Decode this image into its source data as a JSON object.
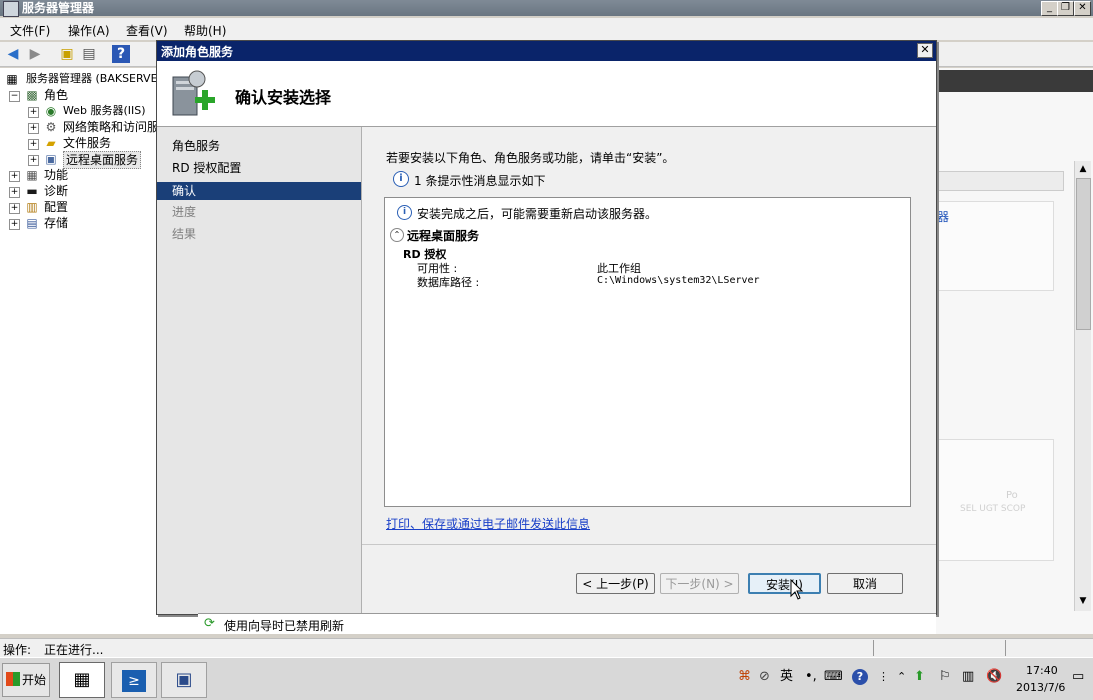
{
  "window": {
    "title": "服务器管理器"
  },
  "menu": [
    "文件(F)",
    "操作(A)",
    "查看(V)",
    "帮助(H)"
  ],
  "tree": {
    "root": "服务器管理器 (BAKSERVE",
    "roles": "角色",
    "web": "Web 服务器(IIS)",
    "nps": "网络策略和访问服",
    "file": "文件服务",
    "rds": "远程桌面服务",
    "features": "功能",
    "diag": "诊断",
    "config": "配置",
    "storage": "存储"
  },
  "dialog": {
    "title": "添加角色服务",
    "heading": "确认安装选择",
    "nav": [
      "角色服务",
      "RD 授权配置",
      "确认",
      "进度",
      "结果"
    ],
    "intro": "若要安装以下角色、角色服务或功能，请单击“安装”。",
    "info_count": "1 条提示性消息显示如下",
    "restart_note": "安装完成之后，可能需要重新启动该服务器。",
    "section": "远程桌面服务",
    "subsection": "RD 授权",
    "rows": [
      {
        "label": "可用性 :",
        "value": "此工作组"
      },
      {
        "label": "数据库路径 :",
        "value": "C:\\Windows\\system32\\LServer"
      }
    ],
    "print_link": "打印、保存或通过电子邮件发送此信息",
    "buttons": {
      "prev": "< 上一步(P)",
      "next": "下一步(N) >",
      "install": "安装(I)",
      "cancel": "取消"
    }
  },
  "right": {
    "fragment1": "器",
    "watermark1": "Po",
    "watermark2": "SEL UGT SCOP"
  },
  "refresh_text": "使用向导时已禁用刷新",
  "status": {
    "label": "操作:",
    "value": "正在进行..."
  },
  "taskbar": {
    "start": "开始",
    "ime": "英",
    "time": "17:40",
    "date": "2013/7/6"
  }
}
